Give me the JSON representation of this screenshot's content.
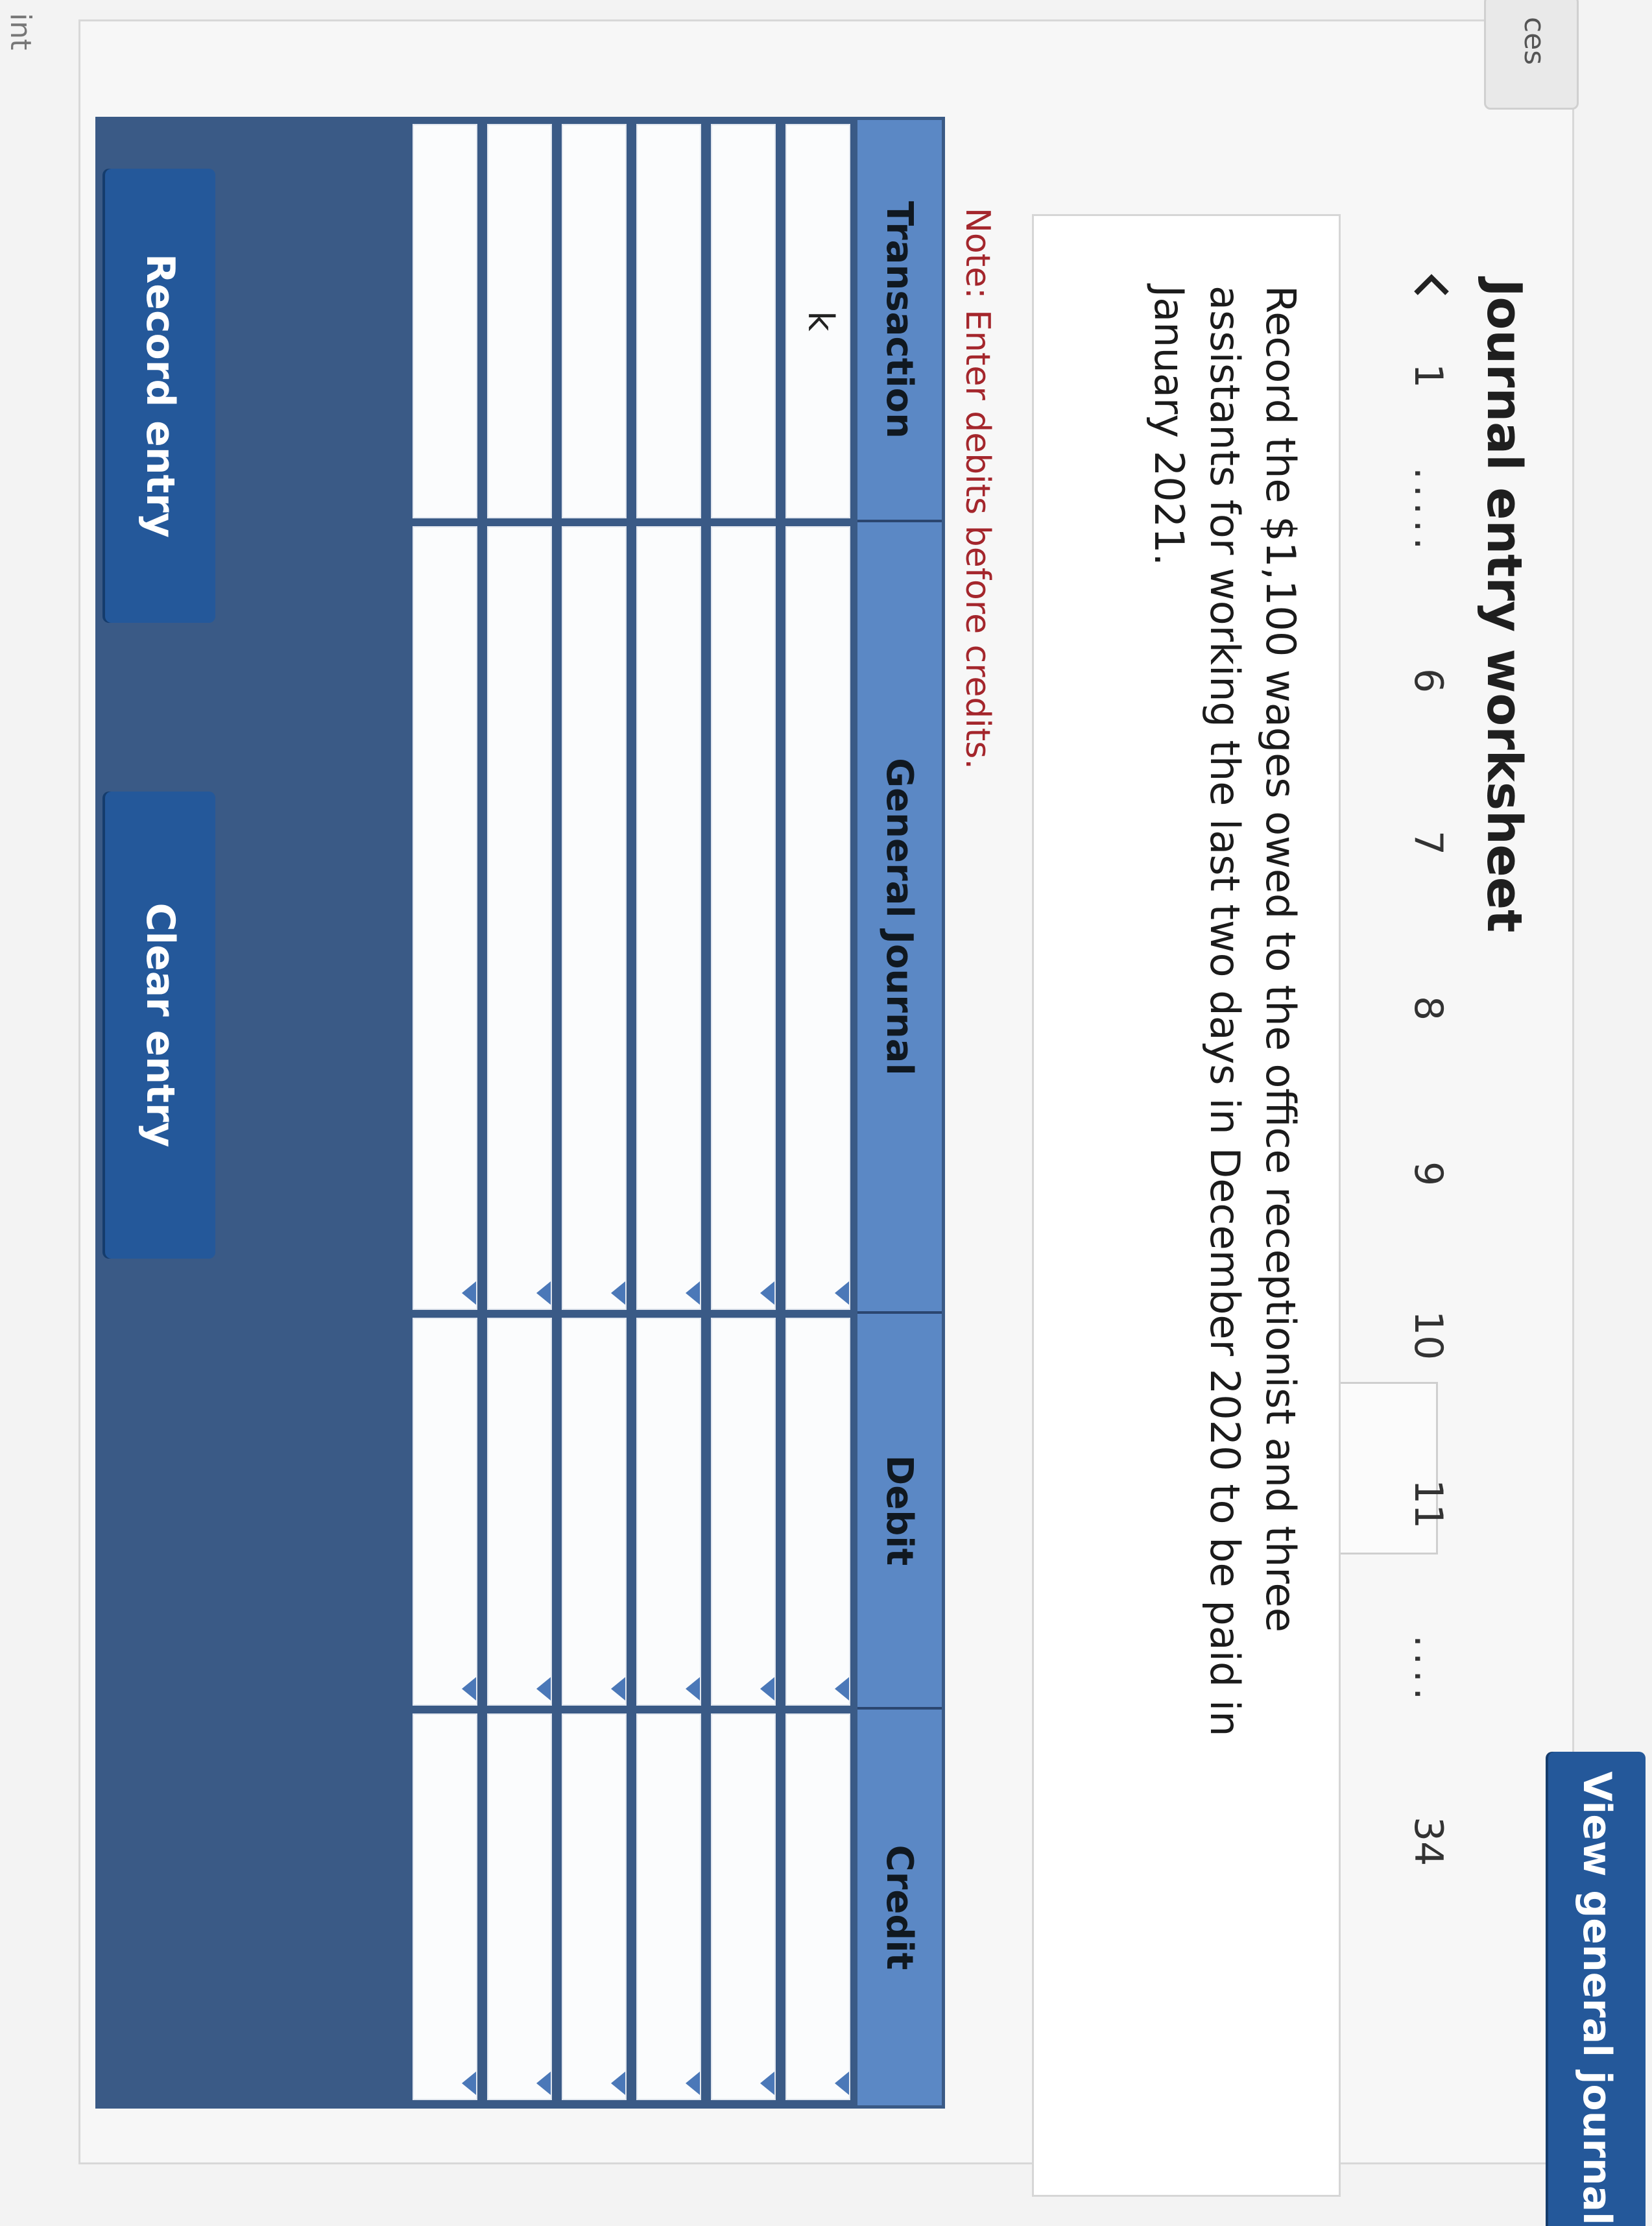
{
  "top_tab": {
    "label": "ces"
  },
  "corner": {
    "label": "int"
  },
  "title": "Journal entry worksheet",
  "pager": {
    "prev_icon": "chevron-left-icon",
    "items": [
      "1",
      ".....",
      "6",
      "7",
      "8",
      "9",
      "10",
      "11",
      "....",
      "34"
    ],
    "active": "11"
  },
  "prompt": "Record the $1,100 wages owed to the office receptionist and three assistants for working the last two days in December 2020 to be paid in January 2021.",
  "note": "Note: Enter debits before credits.",
  "journal": {
    "columns": [
      "Transaction",
      "General Journal",
      "Debit",
      "Credit"
    ],
    "rows": [
      {
        "transaction": "k",
        "account": "",
        "debit": "",
        "credit": ""
      },
      {
        "transaction": "",
        "account": "",
        "debit": "",
        "credit": ""
      },
      {
        "transaction": "",
        "account": "",
        "debit": "",
        "credit": ""
      },
      {
        "transaction": "",
        "account": "",
        "debit": "",
        "credit": ""
      },
      {
        "transaction": "",
        "account": "",
        "debit": "",
        "credit": ""
      },
      {
        "transaction": "",
        "account": "",
        "debit": "",
        "credit": ""
      }
    ]
  },
  "buttons": {
    "record": "Record entry",
    "clear": "Clear entry",
    "view": "View general journal"
  },
  "colors": {
    "header_bg": "#5b88c5",
    "border": "#3a5a86",
    "button_bg": "#24589a",
    "note_text": "#a4262c"
  }
}
